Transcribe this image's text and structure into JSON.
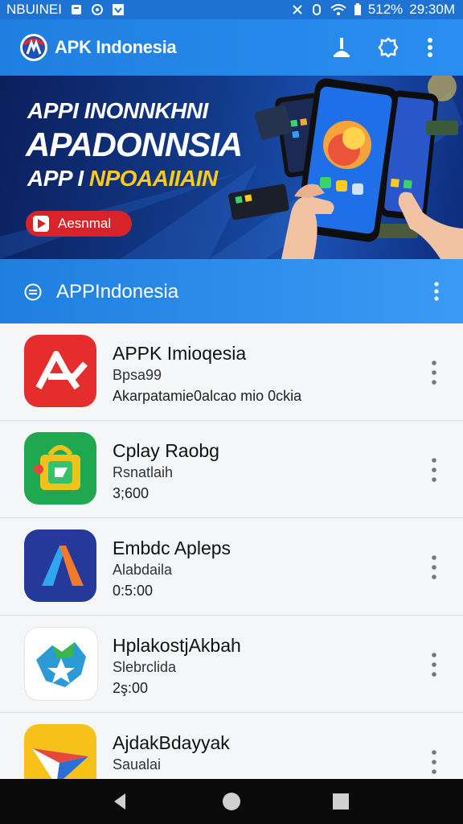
{
  "status_bar": {
    "left_text": "NBUINEI",
    "battery": "512%",
    "time": "29:30M",
    "icons": [
      "notification-icon",
      "whatsapp-icon",
      "download-icon",
      "bluetooth-icon",
      "alarm-icon",
      "wifi-icon",
      "battery-icon"
    ]
  },
  "app_bar": {
    "title": "APK Indonesia",
    "icons": [
      "cleaner-icon",
      "settings-icon",
      "more-vert-icon"
    ],
    "accent": "#1f7fe0"
  },
  "banner": {
    "line1": "APPI INONNKHNI",
    "line2": "APADONNSIA",
    "line3_white": "APP I",
    "line3_yellow": "NPOAAIIAIN",
    "button_label": "Aesnmal",
    "button_color": "#d8232a"
  },
  "section": {
    "title": "APPIndonesia"
  },
  "apps": [
    {
      "name": "APPK Imioqesia",
      "sub": "Bpsa99",
      "desc": "Akarpatamie0alcao mio 0ckia",
      "icon": "red-a-logo-icon"
    },
    {
      "name": "Cplay Raobg",
      "sub": "Rsnatlaih",
      "desc": "3;600",
      "icon": "green-shopping-bag-icon"
    },
    {
      "name": "Embdc Apleps",
      "sub": "Alabdaila",
      "desc": "0:5:00",
      "icon": "blue-a-logo-icon"
    },
    {
      "name": "HplakostjAkbah",
      "sub": "Slebrclida",
      "desc": "2ş:00",
      "icon": "map-star-icon"
    },
    {
      "name": "AjdakBdayyak",
      "sub": "Saualai",
      "desc": "",
      "icon": "paper-plane-icon"
    }
  ]
}
